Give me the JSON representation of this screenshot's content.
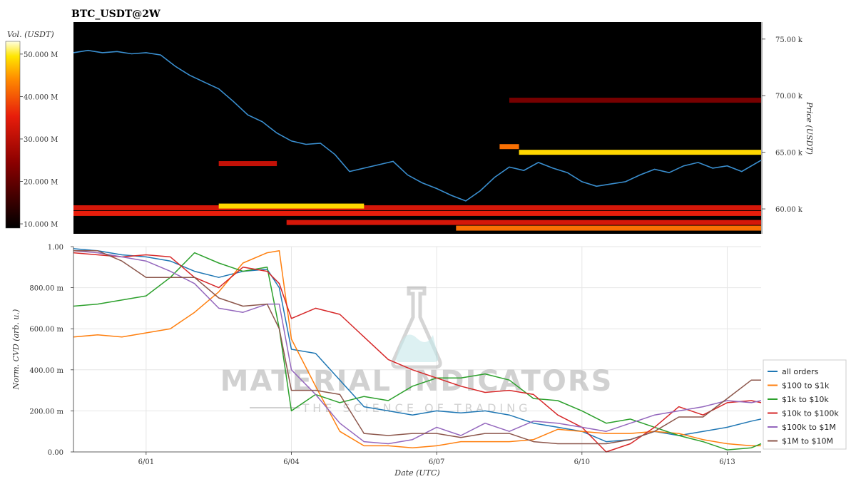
{
  "chart_data": [
    {
      "type": "heatmap",
      "title": "BTC_USDT@2W",
      "ylabel": "Price (USDT)",
      "colorbar_label": "Vol. (USDT)",
      "ylim": [
        57800,
        76500
      ],
      "yticks": [
        {
          "value": 60000,
          "label": "60.00 k"
        },
        {
          "value": 65000,
          "label": "65.00 k"
        },
        {
          "value": 70000,
          "label": "70.00 k"
        },
        {
          "value": 75000,
          "label": "75.00 k"
        }
      ],
      "colorbar_range": [
        9000000,
        53000000
      ],
      "colorbar_ticks": [
        {
          "value": 10000000,
          "label": "10.000 M"
        },
        {
          "value": 20000000,
          "label": "20.000 M"
        },
        {
          "value": 30000000,
          "label": "30.000 M"
        },
        {
          "value": 40000000,
          "label": "40.000 M"
        },
        {
          "value": 50000000,
          "label": "50.000 M"
        }
      ],
      "xlim": [
        0,
        14.2
      ],
      "price_series": {
        "name": "price",
        "color": "#3a8fd0",
        "x": [
          0,
          0.3,
          0.6,
          0.9,
          1.2,
          1.5,
          1.8,
          2.1,
          2.4,
          2.7,
          3.0,
          3.3,
          3.6,
          3.9,
          4.05,
          4.2,
          4.5,
          4.8,
          5.1,
          5.4,
          5.7,
          6.0,
          6.3,
          6.6,
          6.9,
          7.2,
          7.5,
          7.8,
          8.1,
          8.4,
          8.7,
          9.0,
          9.3,
          9.6,
          9.9,
          10.2,
          10.5,
          10.8,
          11.1,
          11.4,
          11.7,
          12.0,
          12.3,
          12.6,
          12.9,
          13.2,
          13.5,
          13.8,
          14.2
        ],
        "y": [
          73800,
          74000,
          73800,
          73900,
          73700,
          73800,
          73600,
          72600,
          71800,
          71200,
          70600,
          69500,
          68300,
          67700,
          67200,
          66700,
          66000,
          65700,
          65800,
          64800,
          63300,
          63600,
          63900,
          64200,
          63000,
          62300,
          61800,
          61200,
          60700,
          61600,
          62800,
          63700,
          63400,
          64100,
          63600,
          63200,
          62400,
          62000,
          62200,
          62400,
          63000,
          63500,
          63200,
          63800,
          64100,
          63600,
          63800,
          63300,
          64300
        ]
      },
      "bands": [
        {
          "y": 59600,
          "x0": 0.0,
          "x1": 14.2,
          "intensity": 0.6
        },
        {
          "y": 60100,
          "x0": 0.0,
          "x1": 14.2,
          "intensity": 0.55
        },
        {
          "y": 60250,
          "x0": 3.0,
          "x1": 6.0,
          "intensity": 0.9
        },
        {
          "y": 58300,
          "x0": 7.9,
          "x1": 14.2,
          "intensity": 0.75
        },
        {
          "y": 58800,
          "x0": 4.4,
          "x1": 14.2,
          "intensity": 0.55
        },
        {
          "y": 65000,
          "x0": 9.2,
          "x1": 14.2,
          "intensity": 0.9
        },
        {
          "y": 65500,
          "x0": 8.8,
          "x1": 9.2,
          "intensity": 0.75
        },
        {
          "y": 64000,
          "x0": 3.0,
          "x1": 4.2,
          "intensity": 0.5
        },
        {
          "y": 69600,
          "x0": 9.0,
          "x1": 14.2,
          "intensity": 0.3
        }
      ]
    },
    {
      "type": "line",
      "xlabel": "Date (UTC)",
      "ylabel": "Norm. CVD (arb. u.)",
      "ylim": [
        0,
        1
      ],
      "xlim": [
        0,
        14.2
      ],
      "xticks": [
        {
          "value": 1.5,
          "label": "6/01"
        },
        {
          "value": 4.5,
          "label": "6/04"
        },
        {
          "value": 7.5,
          "label": "6/07"
        },
        {
          "value": 10.5,
          "label": "6/10"
        },
        {
          "value": 13.5,
          "label": "6/13"
        }
      ],
      "yticks": [
        {
          "value": 0.0,
          "label": "0.00"
        },
        {
          "value": 0.2,
          "label": "200.00 m"
        },
        {
          "value": 0.4,
          "label": "400.00 m"
        },
        {
          "value": 0.6,
          "label": "600.00 m"
        },
        {
          "value": 0.8,
          "label": "800.00 m"
        },
        {
          "value": 1.0,
          "label": "1.00"
        }
      ],
      "x": [
        0,
        0.5,
        1.0,
        1.5,
        2.0,
        2.5,
        3.0,
        3.5,
        4.0,
        4.25,
        4.5,
        5.0,
        5.5,
        6.0,
        6.5,
        7.0,
        7.5,
        8.0,
        8.5,
        9.0,
        9.5,
        10.0,
        10.5,
        11.0,
        11.5,
        12.0,
        12.5,
        13.0,
        13.5,
        14.0,
        14.2
      ],
      "series": [
        {
          "name": "all orders",
          "color": "#1f77b4",
          "values": [
            0.99,
            0.98,
            0.96,
            0.95,
            0.93,
            0.88,
            0.85,
            0.88,
            0.89,
            0.8,
            0.5,
            0.48,
            0.35,
            0.22,
            0.2,
            0.18,
            0.2,
            0.19,
            0.2,
            0.18,
            0.14,
            0.12,
            0.1,
            0.05,
            0.06,
            0.1,
            0.08,
            0.1,
            0.12,
            0.15,
            0.16
          ]
        },
        {
          "name": "$100 to $1k",
          "color": "#ff7f0e",
          "values": [
            0.56,
            0.57,
            0.56,
            0.58,
            0.6,
            0.68,
            0.78,
            0.92,
            0.97,
            0.98,
            0.55,
            0.32,
            0.1,
            0.03,
            0.03,
            0.02,
            0.03,
            0.05,
            0.05,
            0.05,
            0.06,
            0.11,
            0.1,
            0.09,
            0.09,
            0.1,
            0.09,
            0.06,
            0.04,
            0.03,
            0.03
          ]
        },
        {
          "name": "$1k to $10k",
          "color": "#2ca02c",
          "values": [
            0.71,
            0.72,
            0.74,
            0.76,
            0.85,
            0.97,
            0.92,
            0.88,
            0.9,
            0.6,
            0.2,
            0.28,
            0.24,
            0.27,
            0.25,
            0.32,
            0.36,
            0.36,
            0.38,
            0.35,
            0.26,
            0.25,
            0.2,
            0.14,
            0.16,
            0.12,
            0.08,
            0.05,
            0.01,
            0.02,
            0.04
          ]
        },
        {
          "name": "$10k to $100k",
          "color": "#d62728",
          "values": [
            0.97,
            0.96,
            0.95,
            0.96,
            0.95,
            0.85,
            0.8,
            0.9,
            0.88,
            0.82,
            0.65,
            0.7,
            0.67,
            0.56,
            0.45,
            0.4,
            0.36,
            0.32,
            0.29,
            0.3,
            0.28,
            0.18,
            0.12,
            0.0,
            0.04,
            0.12,
            0.22,
            0.18,
            0.24,
            0.25,
            0.24
          ]
        },
        {
          "name": "$100k to $1M",
          "color": "#9467bd",
          "values": [
            0.98,
            0.97,
            0.95,
            0.93,
            0.88,
            0.82,
            0.7,
            0.68,
            0.72,
            0.72,
            0.4,
            0.28,
            0.14,
            0.05,
            0.04,
            0.06,
            0.12,
            0.08,
            0.14,
            0.1,
            0.15,
            0.14,
            0.12,
            0.1,
            0.14,
            0.18,
            0.2,
            0.22,
            0.25,
            0.24,
            0.25
          ]
        },
        {
          "name": "$1M to $10M",
          "color": "#8c564b",
          "values": [
            0.98,
            0.98,
            0.93,
            0.85,
            0.85,
            0.85,
            0.75,
            0.71,
            0.72,
            0.6,
            0.3,
            0.3,
            0.28,
            0.09,
            0.08,
            0.09,
            0.09,
            0.07,
            0.09,
            0.09,
            0.05,
            0.04,
            0.04,
            0.04,
            0.06,
            0.1,
            0.17,
            0.17,
            0.26,
            0.35,
            0.35
          ]
        }
      ],
      "legend_placement": "right"
    }
  ],
  "watermark": {
    "brand": "MATERIAL INDICATORS",
    "tagline": "THE SCIENCE OF TRADING"
  }
}
